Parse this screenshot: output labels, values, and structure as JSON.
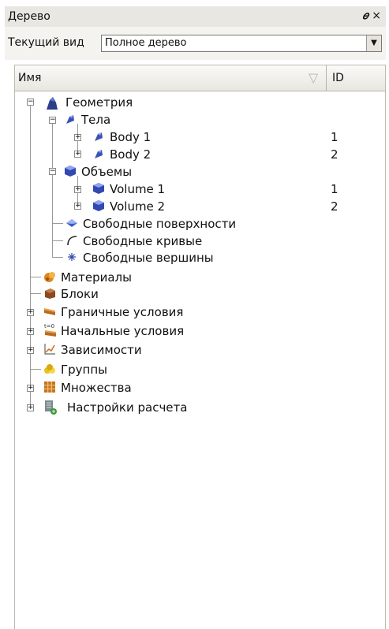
{
  "panel": {
    "title": "Дерево",
    "pin_glyph": "₿",
    "close_glyph": "×"
  },
  "view": {
    "label": "Текущий вид",
    "selected": "Полное дерево"
  },
  "columns": {
    "name": "Имя",
    "id": "ID"
  },
  "tree": {
    "geometry": "Геометрия",
    "bodies": "Тела",
    "body1": {
      "label": "Body 1",
      "id": "1"
    },
    "body2": {
      "label": "Body 2",
      "id": "2"
    },
    "volumes": "Объемы",
    "volume1": {
      "label": "Volume 1",
      "id": "1"
    },
    "volume2": {
      "label": "Volume 2",
      "id": "2"
    },
    "free_surfaces": "Свободные поверхности",
    "free_curves": "Свободные кривые",
    "free_vertices": "Свободные вершины",
    "materials": "Материалы",
    "blocks": "Блоки",
    "boundary": "Граничные условия",
    "initial": "Начальные условия",
    "dependencies": "Зависимости",
    "groups": "Группы",
    "sets": "Множества",
    "settings": "Настройки расчета"
  }
}
